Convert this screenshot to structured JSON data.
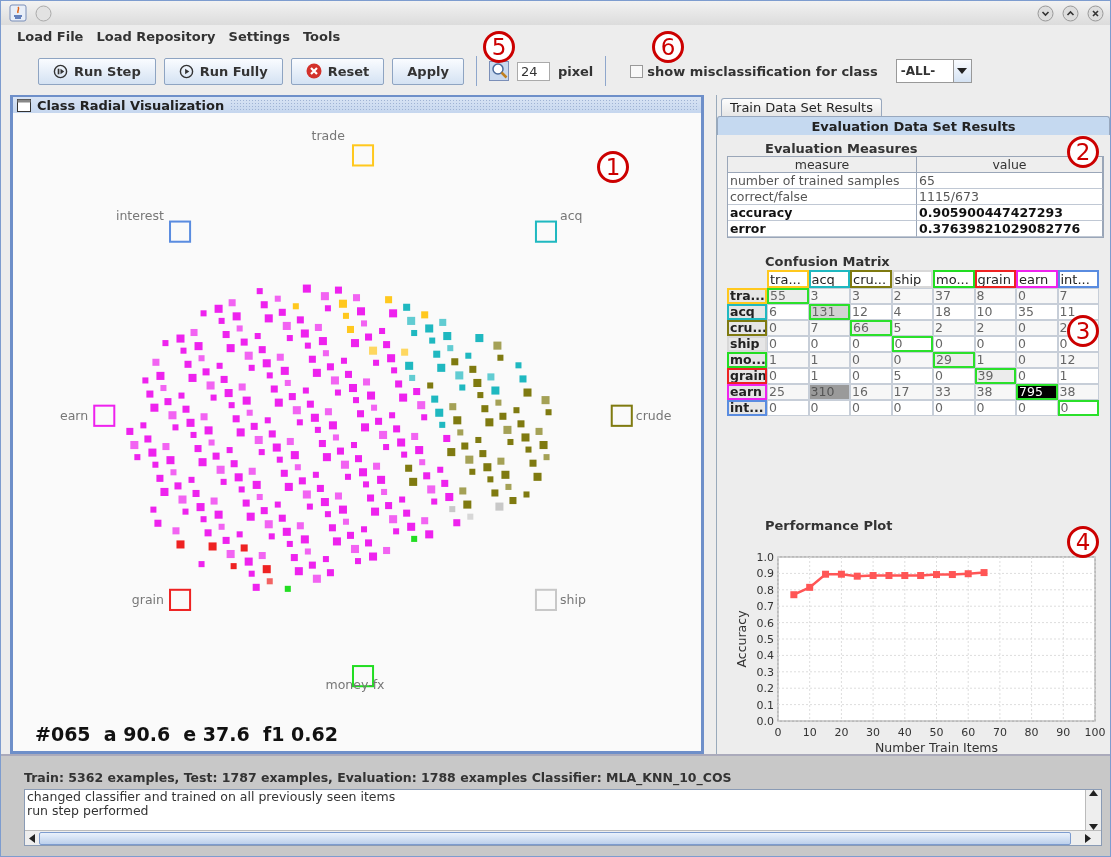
{
  "menu": [
    "Load File",
    "Load Repository",
    "Settings",
    "Tools"
  ],
  "toolbar": {
    "buttons": [
      {
        "label": "Run Step",
        "kind": "step"
      },
      {
        "label": "Run Fully",
        "kind": "play"
      },
      {
        "label": "Reset",
        "kind": "reset"
      },
      {
        "label": "Apply",
        "kind": "plain"
      }
    ],
    "zoom_value": "24",
    "zoom_unit": "pixel",
    "misclassification": {
      "label": "show misclassification for class",
      "checked": false
    },
    "class_select": {
      "value": "-ALL-"
    }
  },
  "visualization": {
    "title": "Class Radial Visualization",
    "classes": [
      {
        "label": "trade",
        "color": "#ffc81e"
      },
      {
        "label": "acq",
        "color": "#1fb8c0"
      },
      {
        "label": "crude",
        "color": "#7f7a10"
      },
      {
        "label": "ship",
        "color": "#c8c8c8"
      },
      {
        "label": "money-fx",
        "color": "#22dd22"
      },
      {
        "label": "grain",
        "color": "#ee2222"
      },
      {
        "label": "earn",
        "color": "#ee22ee"
      },
      {
        "label": "interest",
        "color": "#5a8ce0"
      }
    ],
    "stats": "#065  a 90.6  e 37.6  f1 0.62"
  },
  "results": {
    "tabs": [
      {
        "label": "Train Data Set Results",
        "selected": false
      },
      {
        "label": "Evaluation Data Set Results",
        "selected": true
      }
    ],
    "measures": {
      "title": "Evaluation Measures",
      "columns": [
        "measure",
        "value"
      ],
      "rows": [
        {
          "measure": "number of trained samples",
          "value": "65",
          "emphasized": false
        },
        {
          "measure": "correct/false",
          "value": "1115/673",
          "emphasized": false
        },
        {
          "measure": "accuracy",
          "value": "0.905900447427293",
          "emphasized": true
        },
        {
          "measure": "error",
          "value": "0.37639821029082776",
          "emphasized": true
        }
      ]
    },
    "confusion": {
      "title": "Confusion Matrix",
      "columns": [
        {
          "label": "tra...",
          "color": "#ffc81e"
        },
        {
          "label": "acq",
          "color": "#1fb8c0"
        },
        {
          "label": "cru...",
          "color": "#7f7a10"
        },
        {
          "label": "ship",
          "color": "#d8d8d8"
        },
        {
          "label": "mo...",
          "color": "#22dd22"
        },
        {
          "label": "grain",
          "color": "#ee2222"
        },
        {
          "label": "earn",
          "color": "#ee22ee"
        },
        {
          "label": "int...",
          "color": "#5a8ce0"
        }
      ],
      "rows": [
        {
          "label": "tra...",
          "color": "#ffc81e",
          "cells": [
            {
              "value": "55",
              "kind": "light"
            },
            {
              "value": "3"
            },
            {
              "value": "3"
            },
            {
              "value": "2"
            },
            {
              "value": "37"
            },
            {
              "value": "8"
            },
            {
              "value": "0"
            },
            {
              "value": "7"
            }
          ]
        },
        {
          "label": "acq",
          "color": "#1fb8c0",
          "cells": [
            {
              "value": "6"
            },
            {
              "value": "131",
              "kind": "medium"
            },
            {
              "value": "12"
            },
            {
              "value": "4"
            },
            {
              "value": "18"
            },
            {
              "value": "10"
            },
            {
              "value": "35"
            },
            {
              "value": "11"
            }
          ]
        },
        {
          "label": "cru...",
          "color": "#7f7a10",
          "cells": [
            {
              "value": "0"
            },
            {
              "value": "7"
            },
            {
              "value": "66",
              "kind": "light"
            },
            {
              "value": "5"
            },
            {
              "value": "2"
            },
            {
              "value": "2"
            },
            {
              "value": "0"
            },
            {
              "value": "2"
            }
          ]
        },
        {
          "label": "ship",
          "color": "#d8d8d8",
          "cells": [
            {
              "value": "0"
            },
            {
              "value": "0"
            },
            {
              "value": "0"
            },
            {
              "value": "0"
            },
            {
              "value": "0"
            },
            {
              "value": "0"
            },
            {
              "value": "0"
            },
            {
              "value": "0"
            }
          ]
        },
        {
          "label": "mo...",
          "color": "#22dd22",
          "cells": [
            {
              "value": "1"
            },
            {
              "value": "1"
            },
            {
              "value": "0"
            },
            {
              "value": "0"
            },
            {
              "value": "29",
              "kind": "light"
            },
            {
              "value": "1"
            },
            {
              "value": "0"
            },
            {
              "value": "12"
            }
          ]
        },
        {
          "label": "grain",
          "color": "#ee2222",
          "cells": [
            {
              "value": "0"
            },
            {
              "value": "1"
            },
            {
              "value": "0"
            },
            {
              "value": "5"
            },
            {
              "value": "0"
            },
            {
              "value": "39",
              "kind": "light"
            },
            {
              "value": "0"
            },
            {
              "value": "1"
            }
          ]
        },
        {
          "label": "earn",
          "color": "#ee22ee",
          "cells": [
            {
              "value": "25"
            },
            {
              "value": "310",
              "kind": "dark"
            },
            {
              "value": "16"
            },
            {
              "value": "17"
            },
            {
              "value": "33"
            },
            {
              "value": "38"
            },
            {
              "value": "795",
              "kind": "black"
            },
            {
              "value": "38"
            }
          ]
        },
        {
          "label": "int...",
          "color": "#5a8ce0",
          "cells": [
            {
              "value": "0"
            },
            {
              "value": "0"
            },
            {
              "value": "0"
            },
            {
              "value": "0"
            },
            {
              "value": "0"
            },
            {
              "value": "0"
            },
            {
              "value": "0"
            },
            {
              "value": "0"
            }
          ]
        }
      ]
    },
    "performance": {
      "chart_data": {
        "type": "line",
        "title": "Performance Plot",
        "xlabel": "Number Train Items",
        "ylabel": "Accuracy",
        "x": [
          5,
          10,
          15,
          20,
          25,
          30,
          35,
          40,
          45,
          50,
          55,
          60,
          65
        ],
        "series": [
          {
            "color": "#ff5555",
            "marker": "square",
            "values": [
              0.77,
              0.815,
              0.895,
              0.895,
              0.883,
              0.887,
              0.887,
              0.887,
              0.887,
              0.893,
              0.893,
              0.898,
              0.905
            ]
          }
        ],
        "xlim": [
          0,
          100
        ],
        "ylim": [
          0,
          1
        ],
        "xticks": [
          0,
          10,
          20,
          30,
          40,
          50,
          60,
          70,
          80,
          90,
          100
        ],
        "yticks": [
          {
            "value": 0,
            "label": "0.0"
          },
          {
            "value": 0.1,
            "label": "0.1"
          },
          {
            "value": 0.2,
            "label": "0.2"
          },
          {
            "value": 0.3,
            "label": "0.3"
          },
          {
            "value": 0.4,
            "label": "0.4"
          },
          {
            "value": 0.5,
            "label": "0.5"
          },
          {
            "value": 0.6,
            "label": "0.6"
          },
          {
            "value": 0.7,
            "label": "0.7"
          },
          {
            "value": 0.8,
            "label": "0.8"
          },
          {
            "value": 0.9,
            "label": "0.9"
          },
          {
            "value": 1,
            "label": "1.0"
          }
        ],
        "grid": true
      }
    }
  },
  "status": {
    "summary": "Train: 5362 examples, Test: 1787 examples, Evaluation: 1788 examples Classifier: MLA_KNN_10_COS",
    "log": [
      "changed classifier and trained on all previously seen items",
      "run step performed"
    ]
  },
  "annotations": [
    {
      "label": "1"
    },
    {
      "label": "2"
    },
    {
      "label": "3"
    },
    {
      "label": "4"
    },
    {
      "label": "5"
    },
    {
      "label": "6"
    }
  ]
}
